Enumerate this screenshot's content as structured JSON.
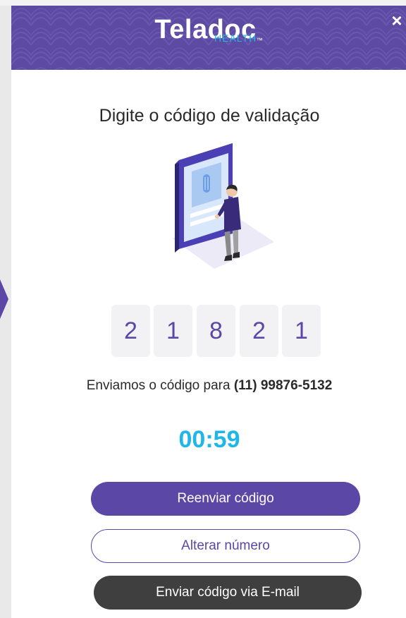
{
  "header": {
    "logo_word": "Teladoc",
    "logo_sub": "HEALTH",
    "logo_tm": "™",
    "close_label": "×"
  },
  "title": "Digite o código de validação",
  "code_digits": [
    "2",
    "1",
    "8",
    "2",
    "1"
  ],
  "sent_message": {
    "prefix": "Enviamos o código para ",
    "phone": "(11) 99876-5132"
  },
  "timer": "00:59",
  "buttons": {
    "resend": "Reenviar código",
    "change_number": "Alterar número",
    "send_email": "Enviar código via E-mail"
  },
  "colors": {
    "brand_purple": "#5b47a6",
    "accent_cyan": "#1fb6e8",
    "dark_button": "#3f3f3f"
  },
  "icons": {
    "close": "close-icon",
    "illustration": "phone-verification-illustration"
  }
}
